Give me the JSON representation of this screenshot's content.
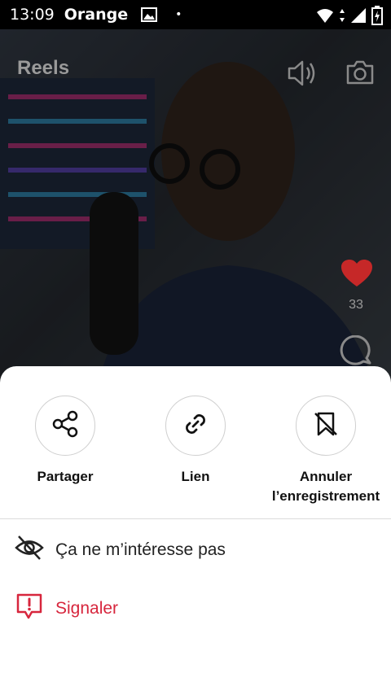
{
  "status_bar": {
    "time": "13:09",
    "carrier": "Orange",
    "dot": "•"
  },
  "reels": {
    "title": "Reels",
    "likes": "33"
  },
  "sheet": {
    "actions": [
      {
        "label": "Partager",
        "icon": "share-icon"
      },
      {
        "label": "Lien",
        "icon": "link-icon"
      },
      {
        "label": "Annuler l’enregistrement",
        "icon": "bookmark-remove-icon"
      }
    ],
    "not_interested": "Ça ne m’intéresse pas",
    "report": "Signaler"
  },
  "colors": {
    "accent_red": "#d7263d",
    "heart_red": "#c62828"
  }
}
